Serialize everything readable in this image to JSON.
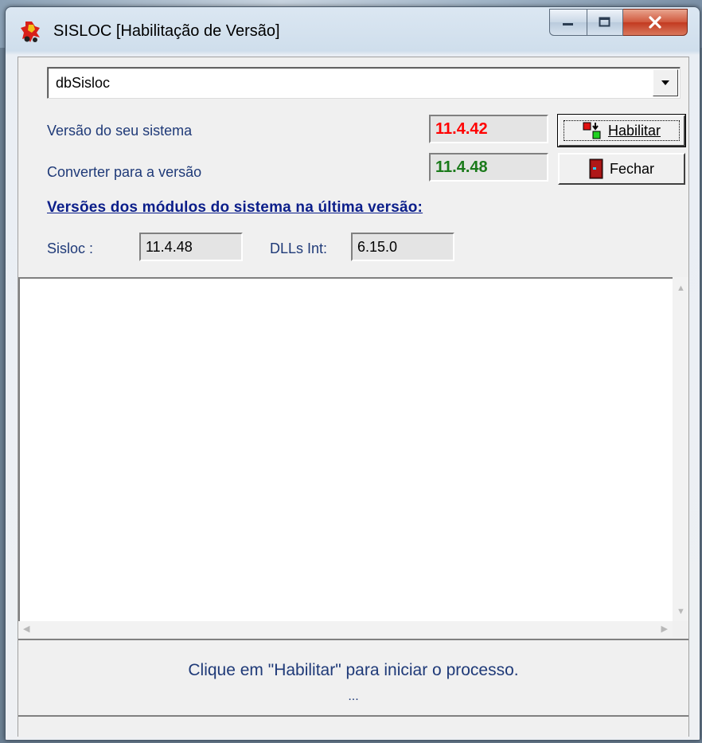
{
  "window": {
    "title": "SISLOC [Habilitação de Versão]"
  },
  "database": {
    "selected": "dbSisloc"
  },
  "versions": {
    "current_label": "Versão do seu sistema",
    "current_value": "11.4.42",
    "target_label": "Converter para a versão",
    "target_value": "11.4.48",
    "current_color": "#ff0000",
    "target_color": "#1a7a1a"
  },
  "buttons": {
    "habilitar_label": "Habilitar",
    "fechar_label": "Fechar"
  },
  "modules": {
    "heading": "Versões dos módulos do sistema na última versão:",
    "sisloc_label": "Sisloc :",
    "sisloc_value": "11.4.48",
    "dlls_label": "DLLs Int:",
    "dlls_value": "6.15.0"
  },
  "status": {
    "message": "Clique em \"Habilitar\" para iniciar o processo.",
    "progress_text": "..."
  }
}
